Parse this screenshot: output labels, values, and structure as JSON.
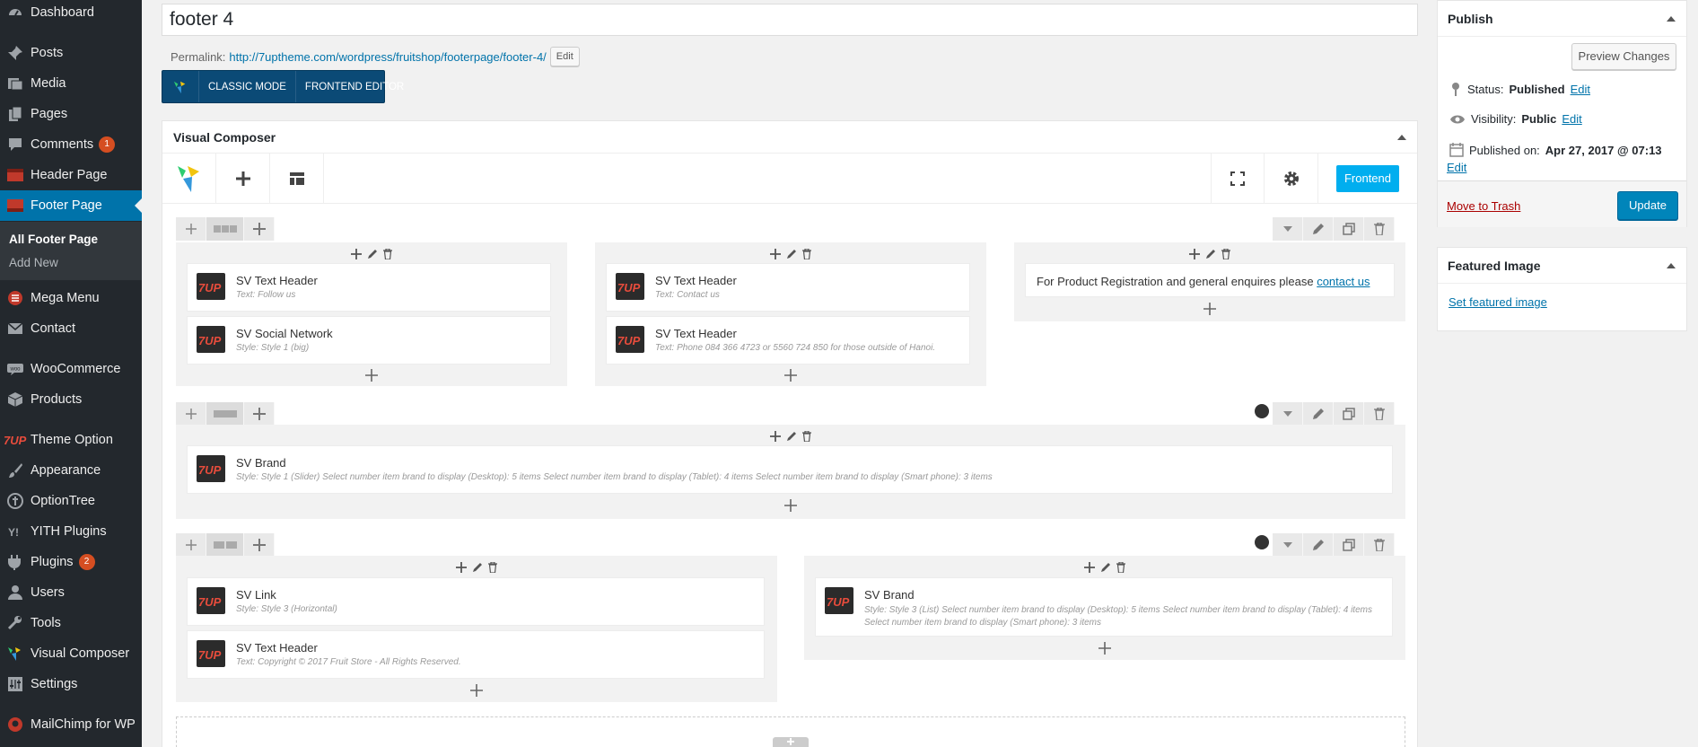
{
  "sidebar": {
    "items": [
      {
        "label": "Dashboard",
        "icon": "dashboard-icon"
      },
      {
        "label": "Posts",
        "icon": "pin-icon"
      },
      {
        "label": "Media",
        "icon": "media-icon"
      },
      {
        "label": "Pages",
        "icon": "pages-icon"
      },
      {
        "label": "Comments",
        "icon": "comment-icon",
        "badge": "1"
      },
      {
        "label": "Header Page",
        "icon": "header-page-icon"
      },
      {
        "label": "Footer Page",
        "icon": "footer-page-icon"
      },
      {
        "label": "Mega Menu",
        "icon": "mega-menu-icon"
      },
      {
        "label": "Contact",
        "icon": "mail-icon"
      },
      {
        "label": "WooCommerce",
        "icon": "woo-icon"
      },
      {
        "label": "Products",
        "icon": "products-icon"
      },
      {
        "label": "Theme Option",
        "icon": "7up-logo-icon"
      },
      {
        "label": "Appearance",
        "icon": "brush-icon"
      },
      {
        "label": "OptionTree",
        "icon": "optiontree-icon"
      },
      {
        "label": "YITH Plugins",
        "icon": "yith-icon"
      },
      {
        "label": "Plugins",
        "icon": "plug-icon",
        "badge": "2"
      },
      {
        "label": "Users",
        "icon": "user-icon"
      },
      {
        "label": "Tools",
        "icon": "wrench-icon"
      },
      {
        "label": "Visual Composer",
        "icon": "vc-icon"
      },
      {
        "label": "Settings",
        "icon": "settings-icon"
      },
      {
        "label": "MailChimp for WP",
        "icon": "mailchimp-icon"
      }
    ],
    "submenu": [
      "All Footer Page",
      "Add New"
    ]
  },
  "editor": {
    "title": "footer 4",
    "permalink_label": "Permalink:",
    "permalink_url": "http://7uptheme.com/wordpress/fruitshop/footerpage/footer-4/",
    "permalink_edit": "Edit",
    "classic_mode": "CLASSIC MODE",
    "frontend_editor": "FRONTEND EDITOR"
  },
  "vc": {
    "title": "Visual Composer",
    "frontend_button": "Frontend",
    "logo_text": "7UP",
    "rows": [
      {
        "columns": [
          {
            "elements": [
              {
                "title": "SV Text Header",
                "desc": "Text: Follow us"
              },
              {
                "title": "SV Social Network",
                "desc": "Style: Style 1 (big)"
              }
            ]
          },
          {
            "elements": [
              {
                "title": "SV Text Header",
                "desc": "Text: Contact us"
              },
              {
                "title": "SV Text Header",
                "desc": "Text: Phone 084 366 4723 or 5560 724 850 for those outside of Hanoi."
              }
            ]
          },
          {
            "text": "For Product Registration and general enquires please",
            "link": "contact us"
          }
        ]
      },
      {
        "columns": [
          {
            "elements": [
              {
                "title": "SV Brand",
                "desc": "Style: Style 1 (Slider)  Select number item brand to display (Desktop): 5 items  Select number item brand to display (Tablet): 4 items  Select number item brand to display (Smart phone): 3 items"
              }
            ]
          }
        ]
      },
      {
        "columns": [
          {
            "elements": [
              {
                "title": "SV Link",
                "desc": "Style: Style 3 (Horizontal)"
              },
              {
                "title": "SV Text Header",
                "desc": "Text: Copyright © 2017 Fruit Store - All Rights Reserved."
              }
            ]
          },
          {
            "elements": [
              {
                "title": "SV Brand",
                "desc": "Style: Style 3 (List)  Select number item brand to display (Desktop): 5 items  Select number item brand to display (Tablet): 4 items  Select number item brand to display (Smart phone): 3 items"
              }
            ]
          }
        ]
      }
    ]
  },
  "publish": {
    "title": "Publish",
    "preview_button": "Preview Changes",
    "status_label": "Status:",
    "status_value": "Published",
    "visibility_label": "Visibility:",
    "visibility_value": "Public",
    "published_label": "Published on:",
    "published_value": "Apr 27, 2017 @ 07:13",
    "edit_link": "Edit",
    "trash_link": "Move to Trash",
    "update_button": "Update"
  },
  "featured": {
    "title": "Featured Image",
    "link": "Set featured image"
  },
  "colors": {
    "accent": "#0073aa",
    "sidebar_bg": "#23282d",
    "frontend_button": "#00aeef",
    "badge": "#d54e21"
  }
}
